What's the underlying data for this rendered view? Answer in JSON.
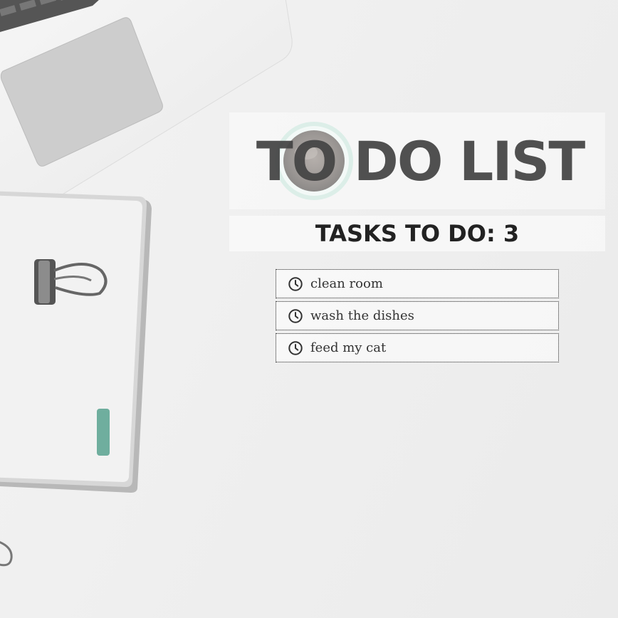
{
  "header": {
    "title": "TO DO LIST",
    "tasks_count_label": "TASKS TO DO: 3"
  },
  "tasks": [
    {
      "label": "clean room",
      "icon": "clock-icon"
    },
    {
      "label": "wash the dishes",
      "icon": "clock-icon"
    },
    {
      "label": "feed my cat",
      "icon": "clock-icon"
    }
  ],
  "colors": {
    "title": "#444444",
    "count": "#222222",
    "accent_mint": "#6fae9e"
  }
}
